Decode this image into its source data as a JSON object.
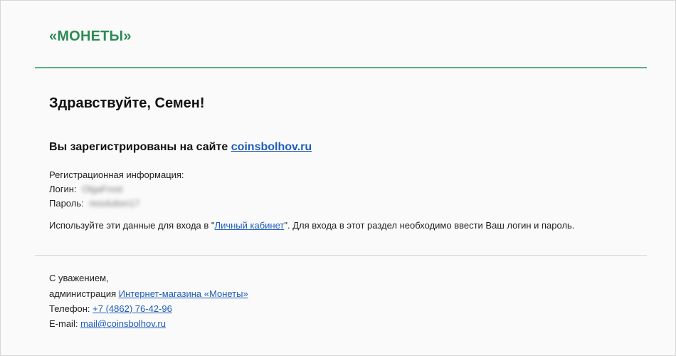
{
  "header": {
    "brand": "«МОНЕТЫ»"
  },
  "greeting": "Здравствуйте, Семен!",
  "registration": {
    "text": "Вы зарегистрированы на сайте",
    "site_link": "coinsbolhov.ru"
  },
  "info": {
    "title": "Регистрационная информация:",
    "login_label": "Логин:",
    "login_value": "OlgaFrost",
    "password_label": "Пароль:",
    "password_value": "resolution17",
    "usage_prefix": "Используйте эти данные для входа в \"",
    "usage_link": "Личный кабинет",
    "usage_suffix": "\". Для входа в этот раздел необходимо ввести Ваш логин и пароль."
  },
  "footer": {
    "regards": "С уважением,",
    "admin_prefix": "администрация",
    "admin_link": "Интернет-магазина «Монеты»",
    "phone_label": "Телефон:",
    "phone_link": "+7 (4862) 76-42-96",
    "email_label": "E-mail:",
    "email_link": "mail@coinsbolhov.ru"
  },
  "colors": {
    "brand": "#2c8a55",
    "header_rule": "#5fae85",
    "link": "#1f5db8",
    "background": "#fafafa"
  }
}
